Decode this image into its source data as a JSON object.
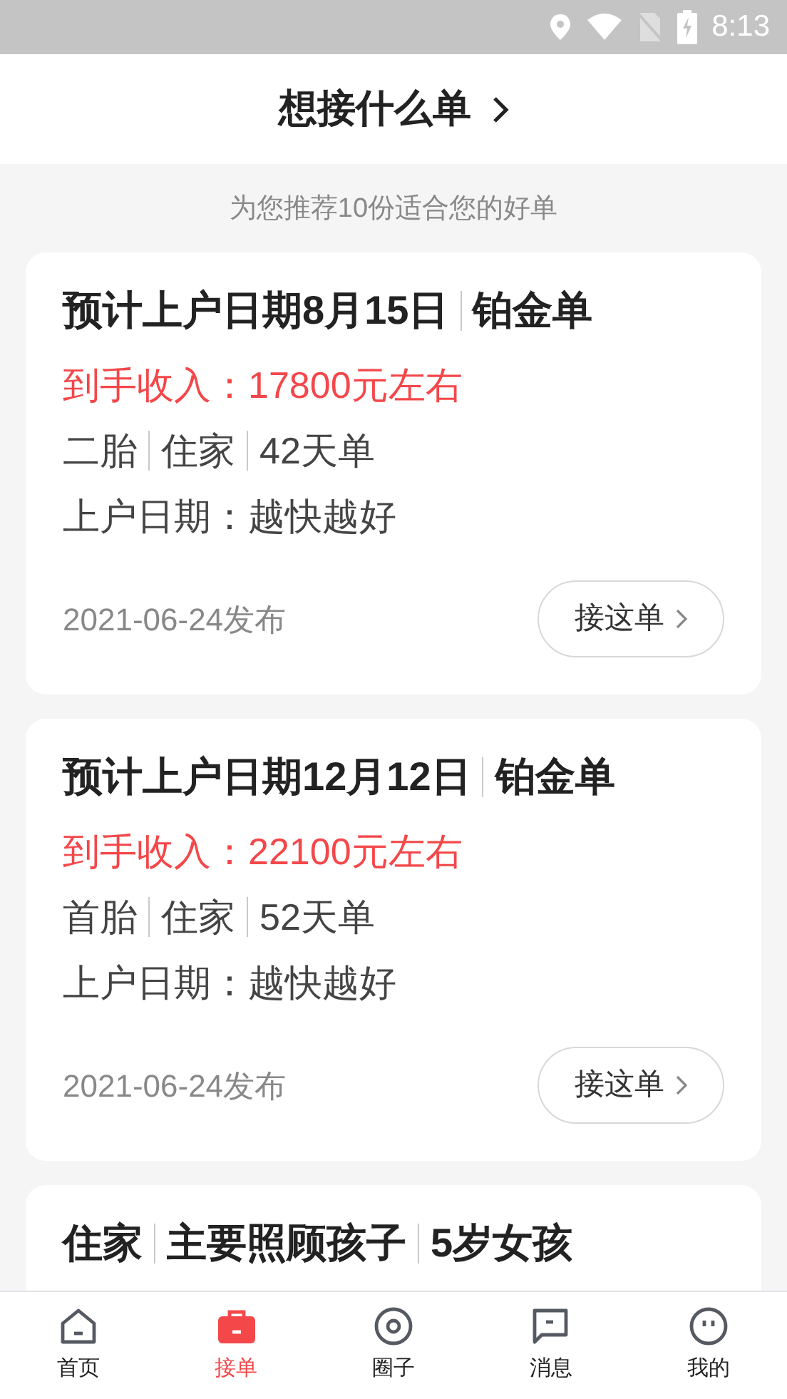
{
  "status_bar": {
    "time": "8:13"
  },
  "header": {
    "title": "想接什么单"
  },
  "subtitle": "为您推荐10份适合您的好单",
  "cards": [
    {
      "title_parts": [
        "预计上户日期8月15日",
        "铂金单"
      ],
      "income": "到手收入：17800元左右",
      "tags": [
        "二胎",
        "住家",
        "42天单"
      ],
      "start": "上户日期：越快越好",
      "date": "2021-06-24发布",
      "button": "接这单"
    },
    {
      "title_parts": [
        "预计上户日期12月12日",
        "铂金单"
      ],
      "income": "到手收入：22100元左右",
      "tags": [
        "首胎",
        "住家",
        "52天单"
      ],
      "start": "上户日期：越快越好",
      "date": "2021-06-24发布",
      "button": "接这单"
    },
    {
      "title_parts": [
        "住家",
        "主要照顾孩子",
        "5岁女孩"
      ]
    }
  ],
  "nav": [
    {
      "label": "首页",
      "kind": "home",
      "selected": false
    },
    {
      "label": "接单",
      "kind": "orders",
      "selected": true
    },
    {
      "label": "圈子",
      "kind": "circle",
      "selected": false
    },
    {
      "label": "消息",
      "kind": "messages",
      "selected": false
    },
    {
      "label": "我的",
      "kind": "profile",
      "selected": false
    }
  ]
}
